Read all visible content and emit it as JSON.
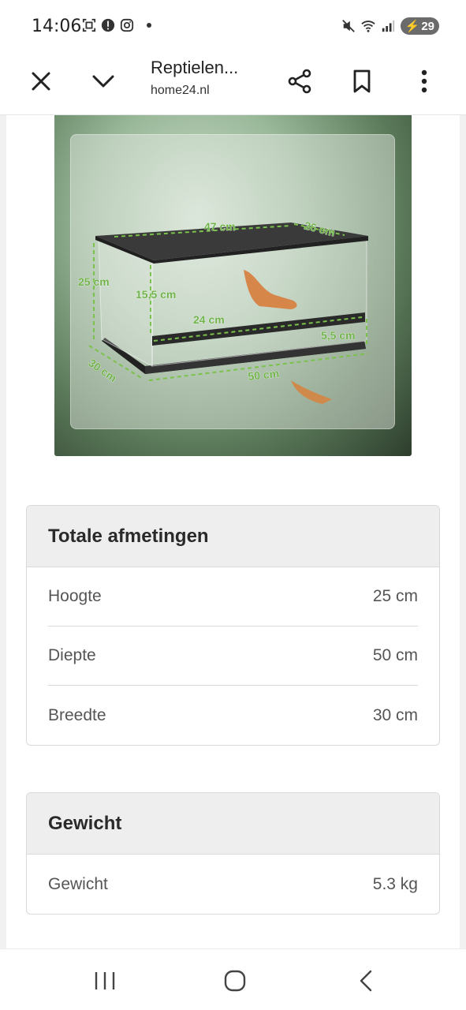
{
  "status_bar": {
    "time": "14:06",
    "battery_level": "29",
    "icons_left": [
      "screenshot-icon",
      "alert-icon",
      "instagram-icon"
    ],
    "icons_right": [
      "mute-icon",
      "wifi-icon",
      "signal-icon",
      "battery-icon"
    ]
  },
  "toolbar": {
    "title": "Reptielen...",
    "url": "home24.nl"
  },
  "product_image": {
    "dimension_labels": [
      "47 cm",
      "26 cm",
      "25 cm",
      "15,5 cm",
      "24 cm",
      "5,5 cm",
      "30 cm",
      "50 cm"
    ],
    "accent_color": "#6fb24a"
  },
  "spec_tables": [
    {
      "title": "Totale afmetingen",
      "rows": [
        {
          "label": "Hoogte",
          "value": "25 cm"
        },
        {
          "label": "Diepte",
          "value": "50 cm"
        },
        {
          "label": "Breedte",
          "value": "30 cm"
        }
      ]
    },
    {
      "title": "Gewicht",
      "rows": [
        {
          "label": "Gewicht",
          "value": "5.3 kg"
        }
      ]
    }
  ],
  "nav_bar": {
    "buttons": [
      "recent-apps",
      "home",
      "back"
    ]
  }
}
